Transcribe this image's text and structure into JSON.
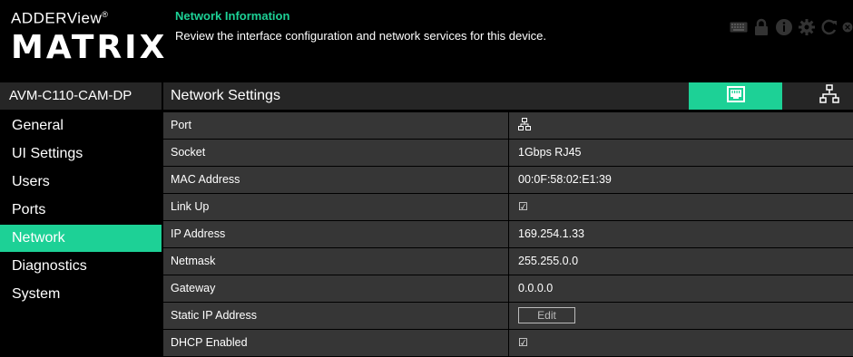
{
  "logo": {
    "brand": "ADDERView",
    "reg": "®",
    "product": "MATRIX"
  },
  "header": {
    "title": "Network Information",
    "description": "Review the interface configuration and network services for this device.",
    "icons": [
      "keyboard-icon",
      "lock-icon",
      "info-icon",
      "settings-icon",
      "refresh-icon",
      "close-icon"
    ]
  },
  "sidebar": {
    "device_name": "AVM-C110-CAM-DP",
    "items": [
      {
        "label": "General"
      },
      {
        "label": "UI Settings"
      },
      {
        "label": "Users"
      },
      {
        "label": "Ports"
      },
      {
        "label": "Network",
        "active": true
      },
      {
        "label": "Diagnostics"
      },
      {
        "label": "System"
      }
    ]
  },
  "panel": {
    "title": "Network Settings",
    "tabs": [
      "ethernet-port-icon",
      "network-topology-icon"
    ],
    "accent": "#1dd196"
  },
  "settings": {
    "port": {
      "label": "Port",
      "value_icon": "network-icon"
    },
    "socket": {
      "label": "Socket",
      "value": "1Gbps RJ45"
    },
    "mac": {
      "label": "MAC Address",
      "value": "00:0F:58:02:E1:39"
    },
    "link_up": {
      "label": "Link Up",
      "value": "☑"
    },
    "ip": {
      "label": "IP Address",
      "value": "169.254.1.33"
    },
    "netmask": {
      "label": "Netmask",
      "value": "255.255.0.0"
    },
    "gateway": {
      "label": "Gateway",
      "value": "0.0.0.0"
    },
    "static_ip": {
      "label": "Static IP Address",
      "button": "Edit"
    },
    "dhcp": {
      "label": "DHCP Enabled",
      "value": "☑"
    }
  }
}
